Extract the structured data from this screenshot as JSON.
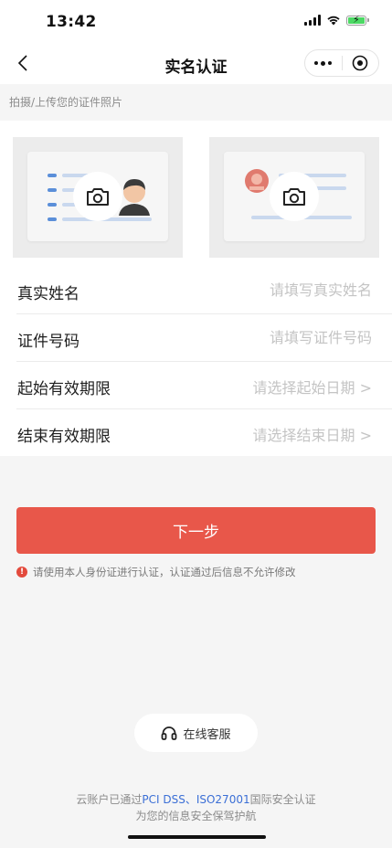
{
  "status_bar": {
    "time": "13:42",
    "battery_color": "#4cd964"
  },
  "nav": {
    "title": "实名认证",
    "back_icon": "chevron-left-icon",
    "more_icon": "more-dots-icon",
    "close_icon": "target-circle-icon"
  },
  "upload": {
    "hint": "拍摄/上传您的证件照片",
    "front_icon": "camera-icon",
    "back_icon": "camera-icon"
  },
  "form": {
    "name_label": "真实姓名",
    "name_placeholder": "请填写真实姓名",
    "id_label": "证件号码",
    "id_placeholder": "请填写证件号码",
    "start_label": "起始有效期限",
    "start_placeholder": "请选择起始日期 >",
    "end_label": "结束有效期限",
    "end_placeholder": "请选择结束日期 >"
  },
  "next_button": {
    "label": "下一步",
    "color": "#e8574a"
  },
  "notice": {
    "icon_text": "!",
    "text": "请使用本人身份证进行认证，认证通过后信息不允许修改"
  },
  "support": {
    "label": "在线客服",
    "icon": "headset-icon"
  },
  "footer": {
    "prefix": "云账户已通过",
    "link": "PCI DSS、ISO27001",
    "suffix": "国际安全认证",
    "line2": "为您的信息安全保驾护航",
    "link_color": "#3b6fd6"
  }
}
